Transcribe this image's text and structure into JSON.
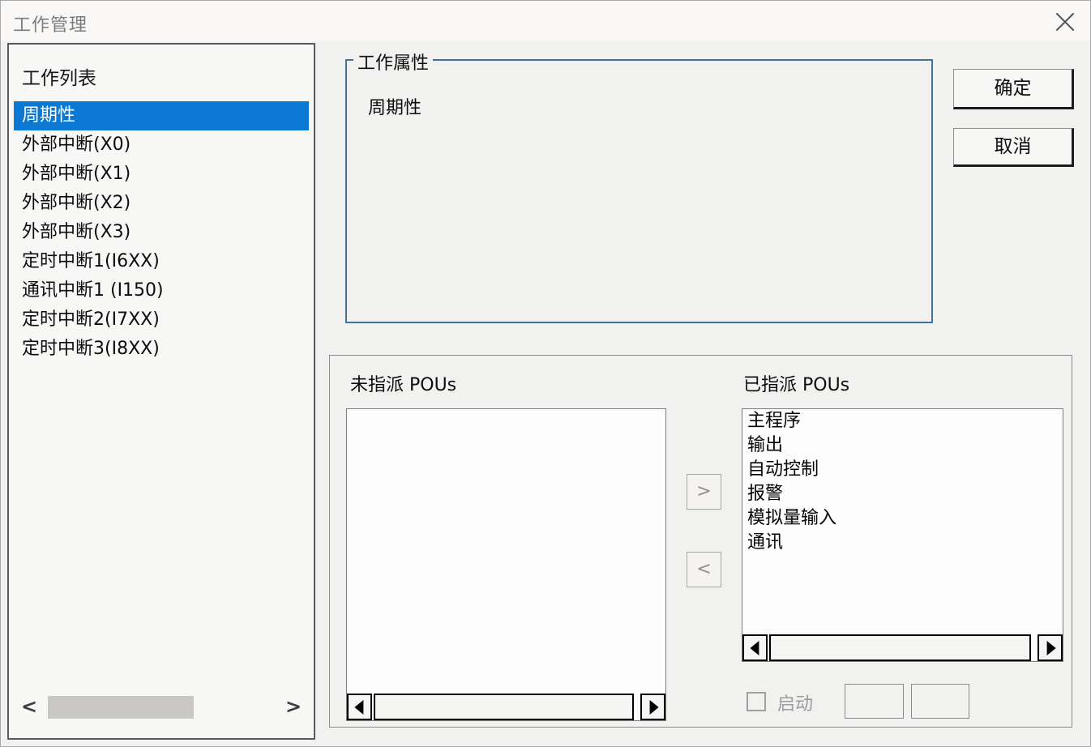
{
  "window": {
    "title": "工作管理"
  },
  "task_list": {
    "header": "工作列表",
    "selected_index": 0,
    "items": [
      "周期性",
      "外部中断(X0)",
      "外部中断(X1)",
      "外部中断(X2)",
      "外部中断(X3)",
      "定时中断1(I6XX)",
      "通讯中断1 (I150)",
      "定时中断2(I7XX)",
      "定时中断3(I8XX)"
    ]
  },
  "task_properties": {
    "group_label": "工作属性",
    "value": "周期性"
  },
  "buttons": {
    "ok": "确定",
    "cancel": "取消"
  },
  "pou_assignment": {
    "unassigned_label": "未指派 POUs",
    "assigned_label": "已指派 POUs",
    "unassigned_items": [],
    "assigned_items": [
      "主程序",
      "输出",
      "自动控制",
      "报警",
      "模拟量输入",
      "通讯"
    ],
    "move_right_label": ">",
    "move_left_label": "<",
    "startup_label": "启动"
  },
  "colors": {
    "selection_blue": "#0b78d4",
    "group_border_blue": "#41719c"
  }
}
